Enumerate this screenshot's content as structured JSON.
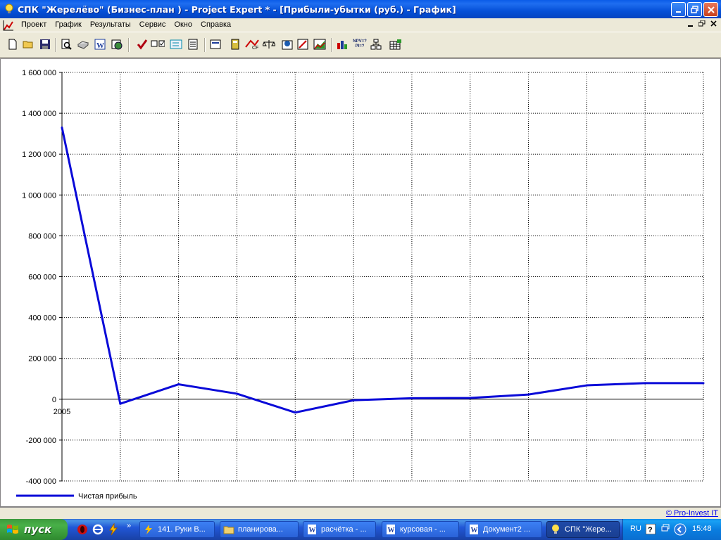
{
  "window": {
    "title": "СПК \"Жерелёво\" (Бизнес-план ) - Project Expert * - [Прибыли-убытки (руб.) - График]"
  },
  "menu": [
    "Проект",
    "График",
    "Результаты",
    "Сервис",
    "Окно",
    "Справка"
  ],
  "toolbar": {
    "icons": [
      "new-icon",
      "open-icon",
      "save-icon",
      "preview-icon",
      "print-icon",
      "word-icon",
      "web-icon",
      "check-icon",
      "checkbox-icon",
      "exchange-icon",
      "report-icon",
      "diagram-icon",
      "calc-icon",
      "cashflow-icon",
      "balance-icon",
      "analysis-icon",
      "graph-icon",
      "chart-icon",
      "bars-icon",
      "npv-pi-icon",
      "tree-icon",
      "table-icon"
    ],
    "npv_text": "NPV=?",
    "pi_text": "PI=?"
  },
  "chart_data": {
    "type": "line",
    "x": [
      0,
      1,
      2,
      3,
      4,
      5,
      6,
      7,
      8,
      9,
      10,
      11
    ],
    "xlabel": "",
    "x_tick_label": "2005",
    "ylabel": "",
    "ylim": [
      -400000,
      1600000
    ],
    "y_ticks": [
      1600000,
      1400000,
      1200000,
      1000000,
      800000,
      600000,
      400000,
      200000,
      0,
      -200000,
      -400000
    ],
    "y_tick_labels": [
      "1 600 000",
      "1 400 000",
      "1 200 000",
      "1 000 000",
      "800 000",
      "600 000",
      "400 000",
      "200 000",
      "0",
      "-200 000",
      "-400 000"
    ],
    "grid": true,
    "series": [
      {
        "name": "Чистая прибыль",
        "color": "#0a0ad8",
        "values": [
          1330000,
          -22000,
          73000,
          27000,
          -65000,
          -5000,
          5000,
          6000,
          23000,
          68000,
          79000,
          79000
        ]
      }
    ],
    "legend": "bottom-left"
  },
  "status": {
    "credit_link": "© Pro-Invest IT"
  },
  "taskbar": {
    "start_label": "пуск",
    "tasks": [
      {
        "label": "141. Руки В...",
        "icon": "lightning-icon"
      },
      {
        "label": "планирова...",
        "icon": "folder-icon"
      },
      {
        "label": "расчётка - ...",
        "icon": "word-doc-icon"
      },
      {
        "label": "курсовая - ...",
        "icon": "word-doc-icon"
      },
      {
        "label": "Документ2 ...",
        "icon": "word-doc-icon"
      },
      {
        "label": "СПК \"Жере...",
        "icon": "bulb-icon",
        "active": true
      }
    ],
    "tray": {
      "lang": "RU",
      "time": "15:48"
    },
    "colors": {
      "taskbar": "#245edb",
      "start": "#3c9a3c",
      "tray": "#0f8cec"
    }
  }
}
